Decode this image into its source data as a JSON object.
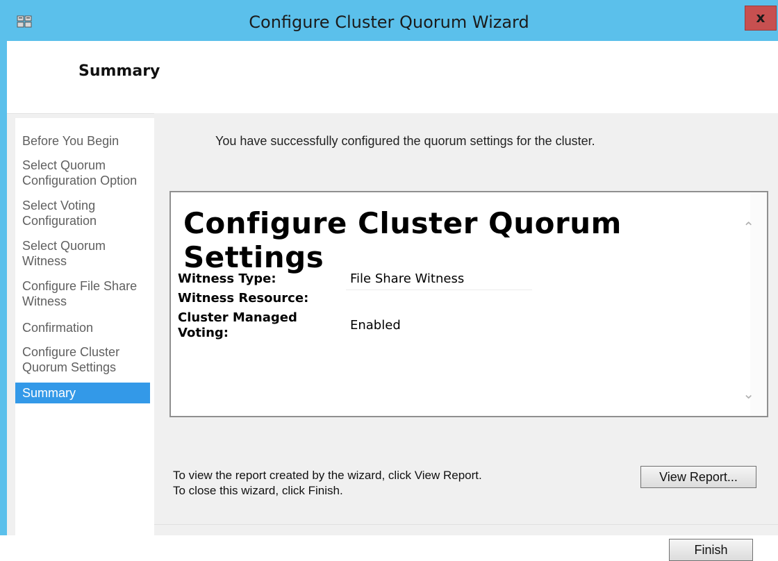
{
  "window": {
    "title": "Configure Cluster Quorum Wizard",
    "close_label": "x"
  },
  "header": {
    "title": "Summary"
  },
  "sidebar": {
    "items": [
      {
        "label": "Before You Begin"
      },
      {
        "label": "Select Quorum\nConfiguration Option"
      },
      {
        "label": "Select Voting\nConfiguration"
      },
      {
        "label": "Select Quorum\nWitness"
      },
      {
        "label": "Configure File Share\nWitness"
      },
      {
        "label": "Confirmation"
      },
      {
        "label": "Configure Cluster\nQuorum Settings"
      },
      {
        "label": "Summary"
      }
    ],
    "active_index": 7
  },
  "main": {
    "success_message": "You have successfully configured the quorum settings for the cluster.",
    "report": {
      "heading": "Configure Cluster Quorum Settings",
      "rows": [
        {
          "label": "Witness Type:",
          "value": "File Share Witness"
        },
        {
          "label": "Witness Resource:",
          "value": ""
        },
        {
          "label": "Cluster Managed\nVoting:",
          "value": "Enabled"
        }
      ]
    },
    "hint_line1": "To view the report created by the wizard, click View Report.",
    "hint_line2": "To close this wizard, click Finish.",
    "view_report_label": "View Report...",
    "finish_label": "Finish"
  },
  "colors": {
    "titlebar": "#5bc0eb",
    "close_button": "#c75050",
    "selected_nav": "#3399e8"
  }
}
